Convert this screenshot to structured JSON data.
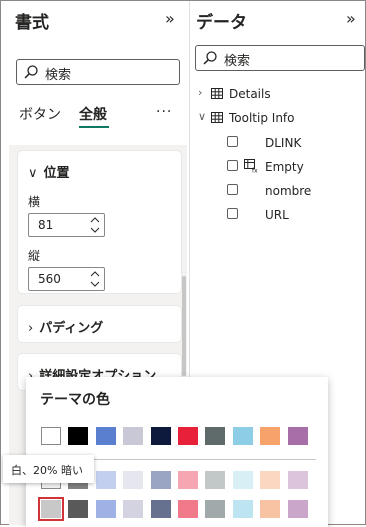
{
  "format_pane": {
    "title": "書式",
    "search_placeholder": "検索",
    "tabs": [
      {
        "label": "ボタン"
      },
      {
        "label": "全般"
      }
    ],
    "more_label": "···",
    "position_section": {
      "title": "位置",
      "x_label": "横",
      "x_value": "81",
      "y_label": "縦",
      "y_value": "560"
    },
    "padding_section": {
      "title": "パディング"
    },
    "advanced_section": {
      "title": "詳細設定オプション"
    }
  },
  "data_pane": {
    "title": "データ",
    "search_placeholder": "検索",
    "tables": [
      {
        "name": "Details",
        "expanded": false,
        "fields": []
      },
      {
        "name": "Tooltip Info",
        "expanded": true,
        "fields": [
          "DLINK",
          "Empty",
          "nombre",
          "URL"
        ]
      }
    ]
  },
  "color_picker": {
    "title": "テーマの色",
    "tooltip": "白、20% 暗い",
    "theme_colors": [
      "#ffffff",
      "#000000",
      "#5b7fcf",
      "#c8c8d6",
      "#0d1a3d",
      "#e8203a",
      "#5f6a6a",
      "#8ecde6",
      "#f7a16b",
      "#a86ea8"
    ],
    "shade_row_1": [
      "#f2f2f2",
      "#808080",
      "#c3cfef",
      "#e6e6ee",
      "#9aa5c4",
      "#f6a6b1",
      "#c2c8c8",
      "#d9eff6",
      "#fbd7c2",
      "#dcc4dc"
    ],
    "shade_row_2": [
      "#c8c8c8",
      "#595959",
      "#9eb2e6",
      "#d3d3e1",
      "#65718f",
      "#f07a8a",
      "#a1aaaa",
      "#bde4f1",
      "#f8c3a3",
      "#caa6ca"
    ],
    "selected_color": "#c8c8c8"
  }
}
